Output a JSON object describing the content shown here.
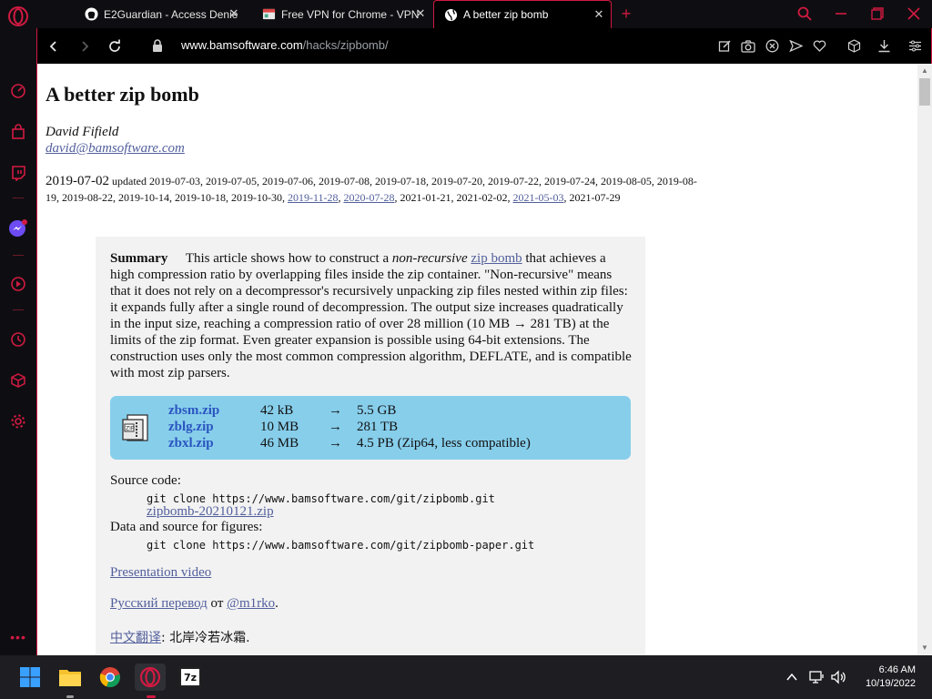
{
  "browser": {
    "tabs": [
      {
        "title": "E2Guardian - Access Denie",
        "favicon": "github-icon",
        "active": false
      },
      {
        "title": "Free VPN for Chrome - VPN",
        "favicon": "vpn-page-icon",
        "active": false
      },
      {
        "title": "A better zip bomb",
        "favicon": "globe-icon",
        "active": true
      }
    ],
    "new_tab_label": "+",
    "url": {
      "host": "www.bamsoftware.com",
      "path": "/hacks/zipbomb/"
    },
    "accent": "#d11a41"
  },
  "page": {
    "title": "A better zip bomb",
    "author": "David Fifield",
    "email": "david@bamsoftware.com",
    "date_primary": "2019-07-02",
    "updated_label": "updated",
    "dates_text": "2019-07-03, 2019-07-05, 2019-07-06, 2019-07-08, 2019-07-18, 2019-07-20, 2019-07-22, 2019-07-24, 2019-08-05, 2019-08-19, 2019-08-22, 2019-10-14, 2019-10-18, 2019-10-30,",
    "date_link_1": "2019-11-28",
    "date_link_2": "2020-07-28",
    "dates_middle": "2021-01-21, 2021-02-02,",
    "date_link_3": "2021-05-03",
    "date_last": "2021-07-29",
    "summary": {
      "label": "Summary",
      "intro": "This article shows how to construct a",
      "intro_em": "non-recursive",
      "intro_link": "zip bomb",
      "body": "that achieves a high compression ratio by overlapping files inside the zip container. \"Non-recursive\" means that it does not rely on a decompressor's recursively unpacking zip files nested within zip files: it expands fully after a single round of decompression. The output size increases quadratically in the input size, reaching a compression ratio of over 28 million (10 MB → 281 TB) at the limits of the zip format. Even greater expansion is possible using 64-bit extensions. The construction uses only the most common compression algorithm, DEFLATE, and is compatible with most zip parsers."
    },
    "downloads": [
      {
        "file": "zbsm.zip",
        "size": "42 kB",
        "arrow": "→",
        "result": "5.5 GB"
      },
      {
        "file": "zblg.zip",
        "size": "10 MB",
        "arrow": "→",
        "result": "281 TB"
      },
      {
        "file": "zbxl.zip",
        "size": "46 MB",
        "arrow": "→",
        "result": "4.5 PB (Zip64, less compatible)"
      }
    ],
    "source_label": "Source code:",
    "source_cmd": "git clone https://www.bamsoftware.com/git/zipbomb.git",
    "source_zip": "zipbomb-20210121.zip",
    "data_label": "Data and source for figures:",
    "data_cmd": "git clone https://www.bamsoftware.com/git/zipbomb-paper.git",
    "video_link": "Presentation video",
    "ru_link": "Русский перевод",
    "ru_by": "от",
    "ru_author": "@m1rko",
    "ru_end": ".",
    "zh_link": "中文翻译",
    "zh_by": ": 北岸冷若冰霜."
  },
  "taskbar": {
    "time": "6:46 AM",
    "date": "10/19/2022",
    "apps": [
      "start-icon",
      "file-explorer-icon",
      "chrome-icon",
      "opera-icon",
      "7zip-icon"
    ],
    "sevenzip_label": "7z"
  }
}
